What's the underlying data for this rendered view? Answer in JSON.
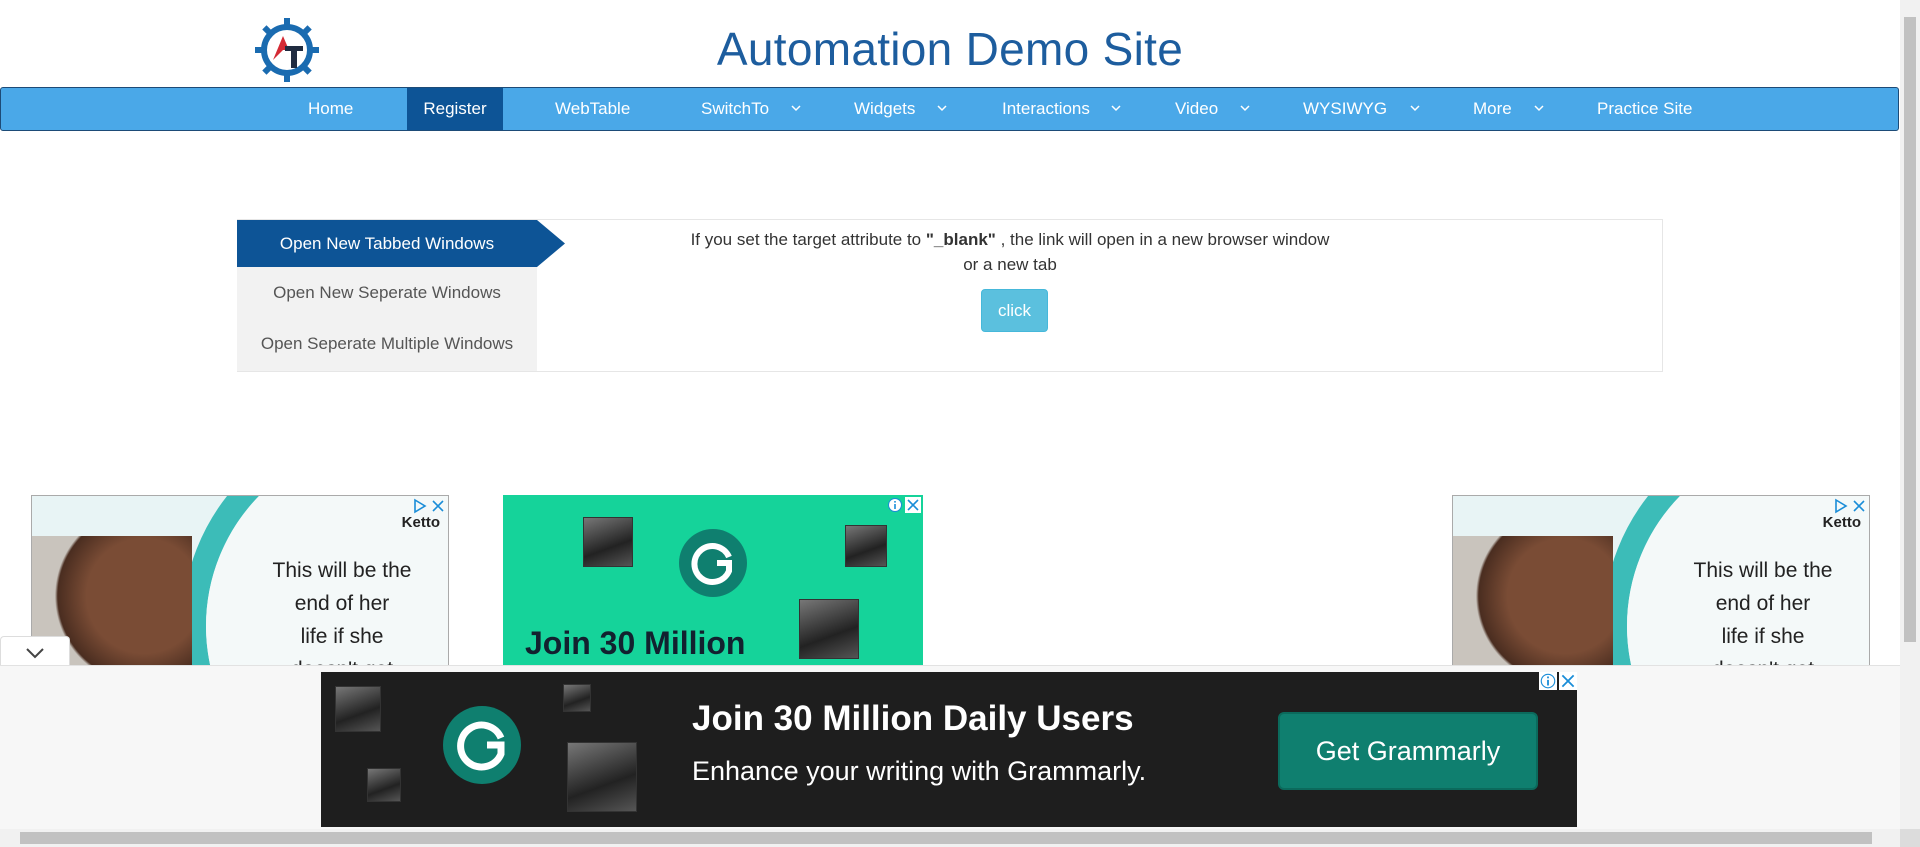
{
  "header": {
    "title": "Automation Demo Site",
    "logo_icon": "gear-logo-icon"
  },
  "nav": {
    "items": [
      {
        "label": "Home",
        "dropdown": false
      },
      {
        "label": "Register",
        "dropdown": false,
        "active": true
      },
      {
        "label": "WebTable",
        "dropdown": false
      },
      {
        "label": "SwitchTo",
        "dropdown": true
      },
      {
        "label": "Widgets",
        "dropdown": true
      },
      {
        "label": "Interactions",
        "dropdown": true
      },
      {
        "label": "Video",
        "dropdown": true
      },
      {
        "label": "WYSIWYG",
        "dropdown": true
      },
      {
        "label": "More",
        "dropdown": true
      },
      {
        "label": "Practice Site",
        "dropdown": false
      }
    ]
  },
  "tabs": [
    {
      "label": "Open New Tabbed Windows",
      "active": true
    },
    {
      "label": "Open New Seperate Windows"
    },
    {
      "label": "Open Seperate Multiple Windows"
    }
  ],
  "content": {
    "desc_prefix": "If you set the target attribute to ",
    "desc_bold": "\"_blank\"",
    "desc_suffix": " , the link will open in a new browser window",
    "desc_line2": "or a new tab",
    "button": "click"
  },
  "ads": {
    "ketto_brand": "Ketto",
    "ketto_lines": [
      "This will be the",
      "end of her",
      "life if she",
      "doesn't get"
    ],
    "grammarly_mid": "Join 30 Million",
    "bottom_headline": "Join 30 Million Daily Users",
    "bottom_sub": "Enhance your writing with Grammarly.",
    "bottom_cta": "Get Grammarly"
  },
  "colors": {
    "nav_bg": "#4aa8e8",
    "active": "#0d5496",
    "title": "#1d5d9e",
    "button": "#5bc0de"
  }
}
